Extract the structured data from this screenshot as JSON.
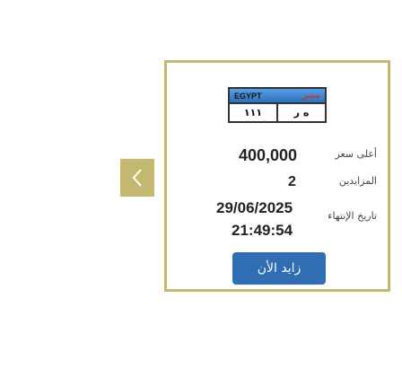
{
  "carousel": {
    "prev_icon": "chevron-left-icon"
  },
  "plate": {
    "country_en": "EGYPT",
    "country_ar": "مصر",
    "number": "١١١",
    "letters": "ه ر"
  },
  "auction": {
    "highest_price_label": "أعلى سعر",
    "highest_price_value": "400,000",
    "bidders_label": "المزايدين",
    "bidders_value": "2",
    "end_date_label": "تاريخ الإنتهاء",
    "end_date": "29/06/2025",
    "end_time": "21:49:54",
    "bid_button_label": "زايد الأن"
  },
  "colors": {
    "frame": "#c4b870",
    "button": "#2f6db5",
    "plate_band": "#2f6fbe"
  }
}
